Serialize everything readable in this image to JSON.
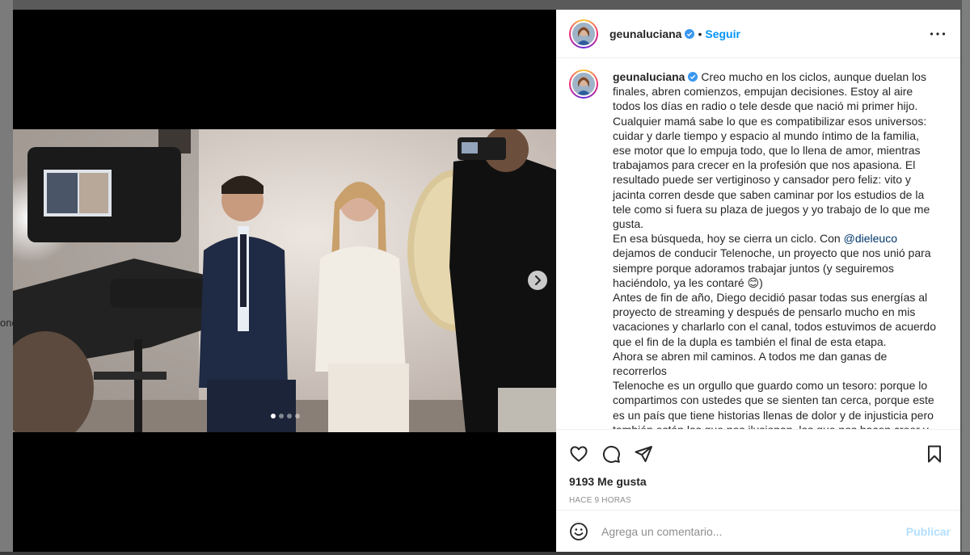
{
  "backdrop": {
    "left_text": "one"
  },
  "post": {
    "username": "geunaluciana",
    "separator": "•",
    "follow_label": "Seguir",
    "more_icon": "more-horizontal-icon",
    "caption_lines": [
      "Creo mucho en los ciclos, aunque duelan los finales, abren comienzos, empujan decisiones. Estoy al aire todos los días en radio o tele desde que nació mi primer hijo. Cualquier mamá sabe lo que es compatibilizar esos universos: cuidar y darle tiempo y espacio al mundo íntimo de la familia, ese motor que lo empuja todo, que lo llena de amor, mientras trabajamos para crecer en la profesión que nos apasiona. El resultado puede ser vertiginoso y cansador pero feliz: vito y jacinta corren desde que saben caminar por los estudios de la tele como si fuera su plaza de juegos y yo trabajo de lo que me gusta.",
      "En esa búsqueda, hoy se cierra un ciclo. Con ",
      "@dieleuco",
      " dejamos de conducir Telenoche, un proyecto que nos unió para siempre porque adoramos trabajar juntos (y seguiremos haciéndolo, ya les contaré 😊)",
      "Antes de fin de año, Diego decidió pasar todas sus energías al proyecto de streaming y después de pensarlo mucho en mis vacaciones y charlarlo con el canal, todos estuvimos de acuerdo que el fin de la dupla es también el final de esta etapa.",
      "Ahora se abren mil caminos. A todos me dan ganas de recorrerlos",
      "Telenoche es un orgullo que guardo como un tesoro: porque lo compartimos con ustedes que se sienten tan cerca, porque este es un país que tiene historias llenas de dolor y de injusticia pero también están las que nos ilusionan, las que nos hacen creer y las"
    ],
    "likes": "9193 Me gusta",
    "time": "HACE 9 HORAS",
    "comment_placeholder": "Agrega un comentario...",
    "publish_label": "Publicar",
    "carousel": {
      "count": 4,
      "active_index": 0
    },
    "colors": {
      "accent": "#0095f6",
      "publish_disabled": "#b2dffc",
      "mention": "#00376b"
    }
  }
}
